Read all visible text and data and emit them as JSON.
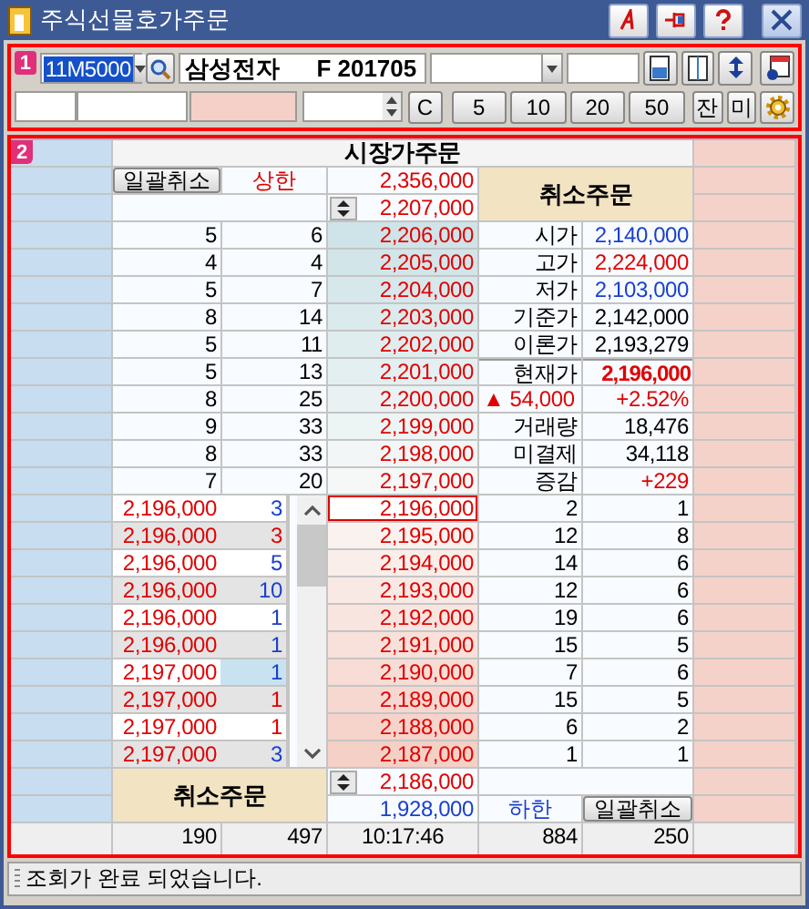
{
  "window": {
    "title": "주식선물호가주문"
  },
  "toolbar": {
    "badge": "1",
    "code": "11M5000",
    "name": "삼성전자",
    "contract": "F 201705",
    "clear_button": "C",
    "quick_buttons": [
      "5",
      "10",
      "20",
      "50"
    ],
    "balance_button": "잔",
    "unfilled_button": "미"
  },
  "order_book": {
    "badge": "2",
    "market_order_header": "시장가주문",
    "cancel_all_top": "일괄취소",
    "upper_limit_label": "상한",
    "upper_limit": "2,356,000",
    "top_price": "2,207,000",
    "cancel_order_top": "취소주문",
    "asks": [
      {
        "orders": "5",
        "count": "6",
        "price": "2,206,000"
      },
      {
        "orders": "4",
        "count": "4",
        "price": "2,205,000"
      },
      {
        "orders": "5",
        "count": "7",
        "price": "2,204,000"
      },
      {
        "orders": "8",
        "count": "14",
        "price": "2,203,000"
      },
      {
        "orders": "5",
        "count": "11",
        "price": "2,202,000"
      },
      {
        "orders": "5",
        "count": "13",
        "price": "2,201,000"
      },
      {
        "orders": "8",
        "count": "25",
        "price": "2,200,000"
      },
      {
        "orders": "9",
        "count": "33",
        "price": "2,199,000"
      },
      {
        "orders": "8",
        "count": "33",
        "price": "2,198,000"
      },
      {
        "orders": "7",
        "count": "20",
        "price": "2,197,000"
      }
    ],
    "info": [
      {
        "kind": "plain",
        "label": "시가",
        "value": "2,140,000",
        "color": "#1a3fcc"
      },
      {
        "kind": "plain",
        "label": "고가",
        "value": "2,224,000",
        "color": "#e00000"
      },
      {
        "kind": "plain",
        "label": "저가",
        "value": "2,103,000",
        "color": "#1a3fcc"
      },
      {
        "kind": "plain",
        "label": "기준가",
        "value": "2,142,000",
        "color": "#000000"
      },
      {
        "kind": "plain",
        "label": "이론가",
        "value": "2,193,279",
        "color": "#000000"
      },
      {
        "kind": "current",
        "label": "현재가",
        "value": "2,196,000",
        "color": "#e00000"
      },
      {
        "kind": "change",
        "label": "▲ 54,000",
        "value": "+2.52%",
        "color": "#e00000"
      },
      {
        "kind": "plain",
        "label": "거래량",
        "value": "18,476",
        "color": "#000000"
      },
      {
        "kind": "plain",
        "label": "미결제",
        "value": "34,118",
        "color": "#000000"
      },
      {
        "kind": "plain",
        "label": "증감",
        "value": "+229",
        "color": "#e00000"
      }
    ],
    "my_orders": [
      {
        "price": "2,196,000",
        "qty": "3",
        "color": "#1a3fcc",
        "selected": false
      },
      {
        "price": "2,196,000",
        "qty": "3",
        "color": "#e00000",
        "selected": false
      },
      {
        "price": "2,196,000",
        "qty": "5",
        "color": "#1a3fcc",
        "selected": false
      },
      {
        "price": "2,196,000",
        "qty": "10",
        "color": "#1a3fcc",
        "selected": false
      },
      {
        "price": "2,196,000",
        "qty": "1",
        "color": "#1a3fcc",
        "selected": false
      },
      {
        "price": "2,196,000",
        "qty": "1",
        "color": "#1a3fcc",
        "selected": false
      },
      {
        "price": "2,197,000",
        "qty": "1",
        "color": "#1a3fcc",
        "selected": true
      },
      {
        "price": "2,197,000",
        "qty": "1",
        "color": "#e00000",
        "selected": false
      },
      {
        "price": "2,197,000",
        "qty": "1",
        "color": "#e00000",
        "selected": false
      },
      {
        "price": "2,197,000",
        "qty": "3",
        "color": "#1a3fcc",
        "selected": false
      }
    ],
    "bids": [
      {
        "price": "2,196,000",
        "orders": "2",
        "count": "1",
        "current": true
      },
      {
        "price": "2,195,000",
        "orders": "12",
        "count": "8",
        "current": false
      },
      {
        "price": "2,194,000",
        "orders": "14",
        "count": "6",
        "current": false
      },
      {
        "price": "2,193,000",
        "orders": "12",
        "count": "6",
        "current": false
      },
      {
        "price": "2,192,000",
        "orders": "19",
        "count": "6",
        "current": false
      },
      {
        "price": "2,191,000",
        "orders": "15",
        "count": "5",
        "current": false
      },
      {
        "price": "2,190,000",
        "orders": "7",
        "count": "6",
        "current": false
      },
      {
        "price": "2,189,000",
        "orders": "15",
        "count": "5",
        "current": false
      },
      {
        "price": "2,188,000",
        "orders": "6",
        "count": "2",
        "current": false
      },
      {
        "price": "2,187,000",
        "orders": "1",
        "count": "1",
        "current": false
      }
    ],
    "cancel_order_bottom": "취소주문",
    "bottom_price": "2,186,000",
    "lower_limit": "1,928,000",
    "lower_limit_label": "하한",
    "cancel_all_bottom": "일괄취소",
    "totals": {
      "ask_orders": "190",
      "ask_count": "497",
      "time": "10:17:46",
      "bid_orders": "884",
      "bid_count": "250"
    }
  },
  "status_bar": {
    "message": "조회가 완료 되었습니다."
  }
}
